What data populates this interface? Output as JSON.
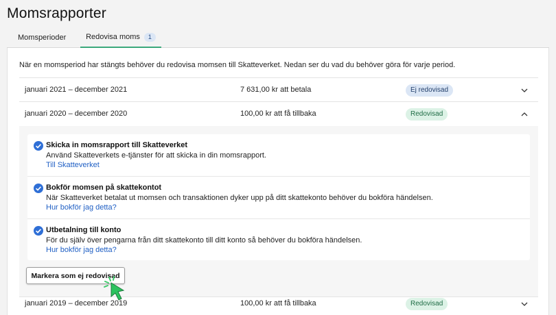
{
  "page": {
    "title": "Momsrapporter"
  },
  "tabs": [
    {
      "label": "Momsperioder",
      "active": false
    },
    {
      "label": "Redovisa moms",
      "active": true,
      "badge": "1"
    }
  ],
  "intro": "När en momsperiod har stängts behöver du redovisa momsen till Skatteverket. Nedan ser du vad du behöver göra för varje period.",
  "periods": [
    {
      "name": "januari 2021 – december 2021",
      "amount": "7 631,00 kr att betala",
      "status": "Ej redovisad",
      "expanded": false
    },
    {
      "name": "januari 2020 – december 2020",
      "amount": "100,00 kr att få tillbaka",
      "status": "Redovisad",
      "expanded": true
    },
    {
      "name": "januari 2019 – december 2019",
      "amount": "100,00 kr att få tillbaka",
      "status": "Redovisad",
      "expanded": false
    }
  ],
  "steps": [
    {
      "title": "Skicka in momsrapport till Skatteverket",
      "desc": "Använd Skatteverkets e-tjänster för att skicka in din momsrapport.",
      "link": "Till Skatteverket"
    },
    {
      "title": "Bokför momsen på skattekontot",
      "desc": "När Skatteverket betalat ut momsen och transaktionen dyker upp på ditt skattekonto behöver du bokföra händelsen.",
      "link": "Hur bokför jag detta?"
    },
    {
      "title": "Utbetalning till konto",
      "desc": "För du själv över pengarna från ditt skattekonto till ditt konto så behöver du bokföra händelsen.",
      "link": "Hur bokför jag detta?"
    }
  ],
  "actions": {
    "mark_unreported": "Markera som ej redovisad"
  },
  "colors": {
    "accent": "#3aa87a",
    "link": "#1f5fc4",
    "check": "#2f6fd6"
  },
  "icons": {
    "step_done": "check-circle-icon",
    "row_collapsed": "chevron-down-icon",
    "row_expanded": "chevron-up-icon",
    "cursor": "pointer-hand-icon"
  }
}
